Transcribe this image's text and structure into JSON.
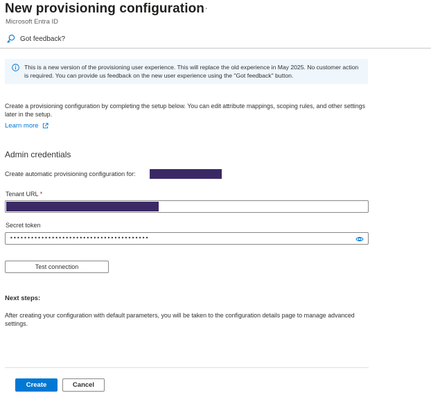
{
  "header": {
    "title": "New provisioning configuration",
    "more_label": "···",
    "subtitle": "Microsoft Entra ID"
  },
  "toolbar": {
    "feedback_label": "Got feedback?",
    "feedback_icon": "feedback-icon"
  },
  "banner": {
    "icon": "info-icon",
    "text": "This is a new version of the provisioning user experience. This will replace the old experience in May 2025. No customer action is required. You can provide us feedback on the new user experience using the \"Got feedback\" button."
  },
  "intro": {
    "text": "Create a provisioning configuration by completing the setup below. You can edit attribute mappings, scoping rules, and other settings later in the setup.",
    "learn_more": "Learn more",
    "learn_more_icon": "external-link-icon"
  },
  "admin": {
    "section_title": "Admin credentials",
    "create_for_label": "Create automatic provisioning configuration for:",
    "tenant_url_label": "Tenant URL",
    "required_marker": "*",
    "secret_token_label": "Secret token",
    "secret_token_value": "••••••••••••••••••••••••••••••••••••••••",
    "reveal_icon": "eye-icon",
    "test_button": "Test connection"
  },
  "next_steps": {
    "title": "Next steps:",
    "text": "After creating your configuration with default parameters, you will be taken to the configuration details page to manage advanced settings."
  },
  "footer": {
    "create_label": "Create",
    "cancel_label": "Cancel"
  },
  "colors": {
    "accent": "#0078d4",
    "banner_bg": "#eff6fc",
    "redaction": "#3b2966",
    "required": "#a4262c"
  }
}
